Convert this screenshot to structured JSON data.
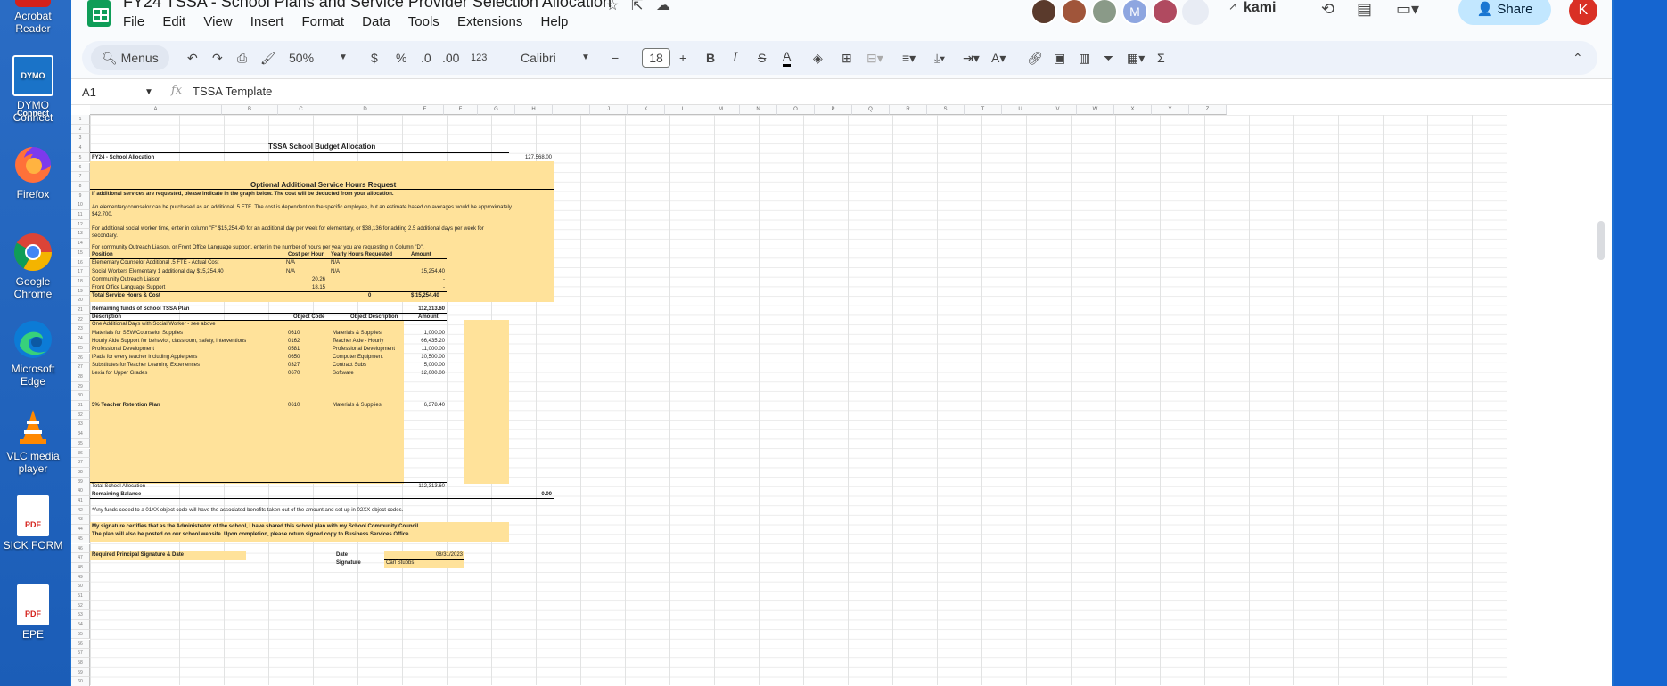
{
  "desktop": {
    "icons": [
      {
        "label": "Acrobat Reader",
        "icon": "acrobat-icon"
      },
      {
        "label": "DYMO Connect",
        "icon": "dymo-icon"
      },
      {
        "label": "Firefox",
        "icon": "firefox-icon"
      },
      {
        "label": "Google Chrome",
        "icon": "chrome-icon"
      },
      {
        "label": "Microsoft Edge",
        "icon": "edge-icon"
      },
      {
        "label": "VLC media player",
        "icon": "vlc-icon"
      },
      {
        "label": "SICK FORM",
        "icon": "pdf-icon"
      },
      {
        "label": "EPE",
        "icon": "pdf-icon"
      }
    ],
    "pdf_badge": "PDF",
    "dymo_badge": "DYMO Connect"
  },
  "app": {
    "title": "FY24 TSSA - School Plans and Service Provider Selection Allocation",
    "menu": [
      "File",
      "Edit",
      "View",
      "Insert",
      "Format",
      "Data",
      "Tools",
      "Extensions",
      "Help"
    ],
    "kami_label": "kami",
    "share_label": "Share",
    "profile_initial": "K",
    "collaborator_initial": "M"
  },
  "toolbar": {
    "menus_label": "Menus",
    "zoom": "50%",
    "currency": "$",
    "percent": "%",
    "dec_decrease": ".0",
    "dec_increase": ".00",
    "format_123": "123",
    "font": "Calibri",
    "font_size": "18",
    "bold": "B",
    "italic": "I",
    "sum": "Σ"
  },
  "formula_bar": {
    "cell_ref": "A1",
    "fx": "fx",
    "content": "TSSA Template"
  },
  "columns": [
    "A",
    "B",
    "C",
    "D",
    "E",
    "F",
    "G",
    "H",
    "I",
    "J",
    "K",
    "L",
    "M",
    "N",
    "O",
    "P",
    "Q",
    "R",
    "S",
    "T",
    "U",
    "V",
    "W",
    "X",
    "Y",
    "Z"
  ],
  "sheet": {
    "main_title": "TSSA School Budget Allocation",
    "fy24_label": "FY24 - School Allocation",
    "fy24_amount": "127,568.00",
    "optional_title": "Optional Additional Service Hours Request",
    "instructions_bold": "If additional services are requested, please indicate in the graph below.  The cost will be deducted from your allocation.",
    "instructions_1": "An elementary counselor can be purchased as an additional .5 FTE.  The cost is dependent on the specific employee, but an estimate based on averages would be approximately",
    "instructions_1b": "$42,700.",
    "instructions_2": "For additional social worker time, enter in column \"F\" $15,254.40 for an additional day per week for elementary, or $38,136 for adding 2.5 additional days per week for",
    "instructions_2b": "secondary.",
    "instructions_3": "For community Outreach Liaison, or Front Office Language support, enter in the number of hours per year you are requesting in Column \"D\".",
    "service_headers": [
      "Position",
      "Cost per Hour",
      "Yearly Hours Requested",
      "Amount"
    ],
    "service_rows": [
      {
        "position": "Elementary Counselor Additional .5 FTE - Actual Cost",
        "cost": "N/A",
        "hours": "N/A",
        "amount": ""
      },
      {
        "position": "Social Workers Elementary 1 additional day $15,254.40",
        "cost": "N/A",
        "hours": "N/A",
        "amount": "15,254.40"
      },
      {
        "position": "Community Outreach Liaison",
        "cost": "20.26",
        "hours": "",
        "amount": "-"
      },
      {
        "position": "Front Office Language Support",
        "cost": "18.15",
        "hours": "",
        "amount": "-"
      }
    ],
    "service_total_label": "Total Service Hours & Cost",
    "service_total_hours": "0",
    "service_total_amount": "$   15,254.40",
    "remaining_label": "Remaining funds of School TSSA Plan",
    "remaining_amount": "112,313.60",
    "plan_headers": [
      "Description",
      "Object Code",
      "Object Description",
      "Amount"
    ],
    "plan_rows": [
      {
        "desc": "One Additional Days with Social Worker - see above",
        "code": "",
        "obj": "",
        "amt": ""
      },
      {
        "desc": "Materials for SEW/Counselor Supplies",
        "code": "0610",
        "obj": "Materials & Supplies",
        "amt": "1,000.00"
      },
      {
        "desc": "Hourly Aide Support for behavior, classroom, safety, interventions",
        "code": "0162",
        "obj": "Teacher Aide - Hourly",
        "amt": "66,435.20"
      },
      {
        "desc": "Professional Development",
        "code": "0581",
        "obj": "Professional Development",
        "amt": "11,000.00"
      },
      {
        "desc": "iPads for every teacher including Apple pens",
        "code": "0650",
        "obj": "Computer Equipment",
        "amt": "10,500.00"
      },
      {
        "desc": "Substitutes for Teacher Learning Experiences",
        "code": "0327",
        "obj": "Contract Subs",
        "amt": "5,000.00"
      },
      {
        "desc": "Lexia for Upper Grades",
        "code": "0670",
        "obj": "Software",
        "amt": "12,000.00"
      }
    ],
    "retention_label": "5% Teacher Retention Plan",
    "retention_code": "0610",
    "retention_obj": "Materials & Supplies",
    "retention_amt": "6,378.40",
    "total_alloc_label": "Total School Allocation",
    "total_alloc_amount": "112,313.60",
    "remaining_balance_label": "Remaining Balance",
    "remaining_balance_amount": "0.00",
    "footnote": "*Any funds coded to a 01XX object code will have the associated benefits taken out of the amount and set up in 02XX object codes.",
    "cert_1": "My signature certifies that as the Administrator of the school, I have shared this school plan with my School Community Council.",
    "cert_2": "The plan will also be posted on our school website.  Upon completion, please return signed copy to Business Services Office.",
    "sig_required": "Required Principal Signature & Date",
    "date_label": "Date",
    "date_value": "08/31/2023",
    "signature_label": "Signature",
    "signature_value": "Carl Stubbs"
  },
  "colors": {
    "highlight": "#ffe29a",
    "accent_green": "#0f9d58",
    "share_bg": "#c2e7ff",
    "desktop_bg": "#1e6fcf"
  }
}
